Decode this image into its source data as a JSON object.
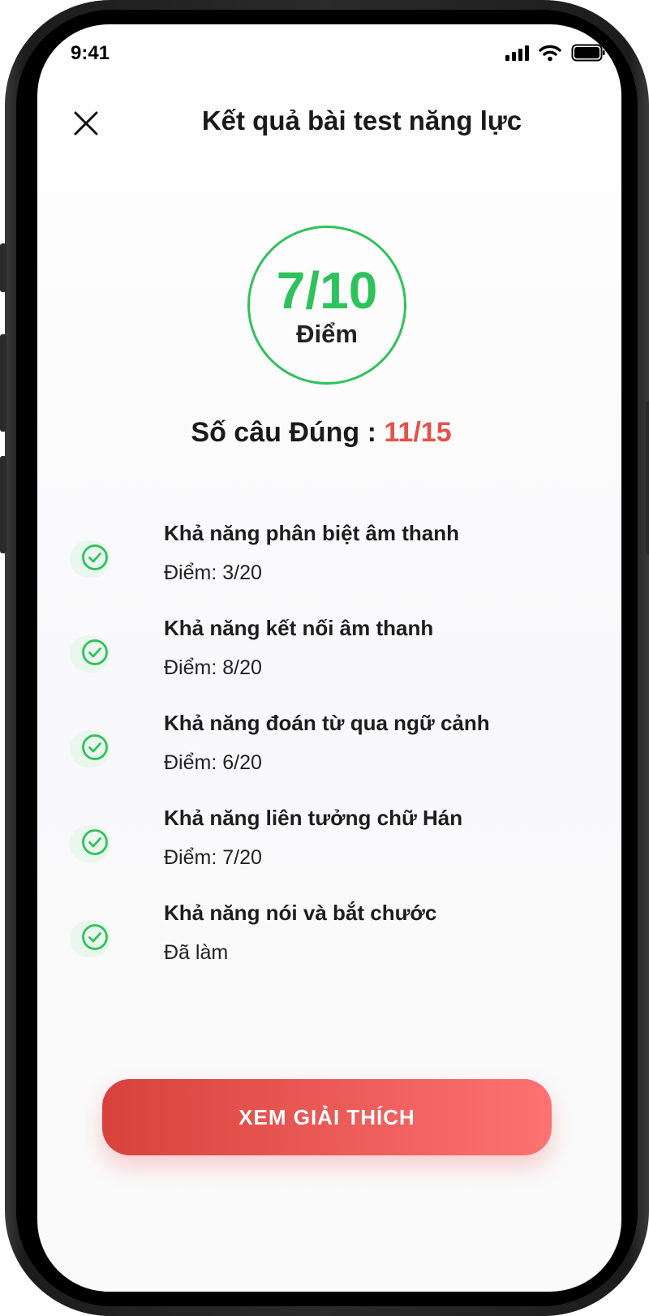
{
  "status_bar": {
    "time": "9:41"
  },
  "header": {
    "title": "Kết quả bài test năng lực"
  },
  "score": {
    "value": "7/10",
    "unit": "Điểm",
    "progress_fraction": 0.7
  },
  "correct": {
    "label": "Số câu Đúng : ",
    "value": "11/15"
  },
  "skills": [
    {
      "name": "Khả năng phân biệt âm thanh",
      "score": "Điểm: 3/20"
    },
    {
      "name": "Khả năng kết nối âm thanh",
      "score": "Điểm: 8/20"
    },
    {
      "name": "Khả năng đoán từ qua ngữ cảnh",
      "score": "Điểm: 6/20"
    },
    {
      "name": " Khả năng liên tưởng chữ Hán",
      "score": "Điểm: 7/20"
    },
    {
      "name": "Khả năng nói và bắt chước",
      "score": "Đã làm"
    }
  ],
  "cta": {
    "label": "XEM GIẢI THÍCH"
  },
  "colors": {
    "green": "#2fc25b",
    "red": "#e4524a",
    "button_start": "#d9423c",
    "button_end": "#fd7372"
  },
  "icons": {
    "close": "close-icon",
    "check": "check-circle-icon",
    "signal": "signal-icon",
    "wifi": "wifi-icon",
    "battery": "battery-icon"
  }
}
